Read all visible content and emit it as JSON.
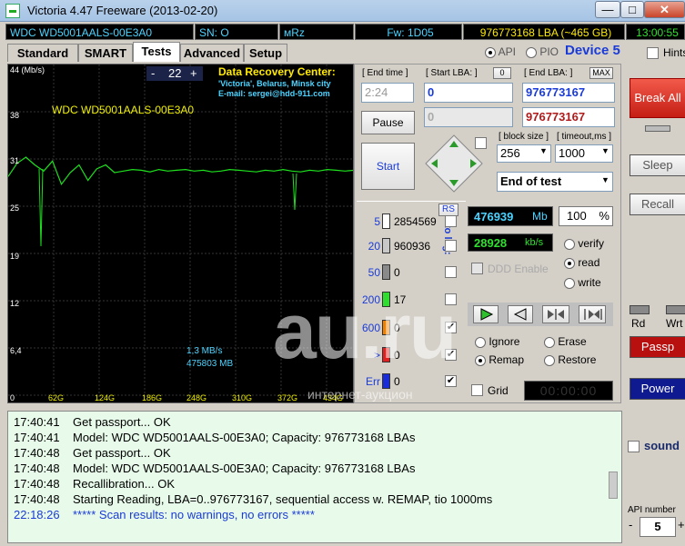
{
  "window": {
    "title": "Victoria 4.47  Freeware (2013-02-20)",
    "minimize": "—",
    "maximize": "□",
    "close": "✕"
  },
  "info": {
    "drive": "WDC WD5001AALS-00E3A0",
    "sn": "SN: O",
    "mrz": "мRz",
    "fw": "Fw: 1D05",
    "lba": "976773168 LBA (~465 GB)",
    "clock": "13:00:55"
  },
  "tabs": [
    "Standard",
    "SMART",
    "Tests",
    "Advanced",
    "Setup"
  ],
  "api": {
    "api_label": "API",
    "pio_label": "PIO",
    "device": "Device 5",
    "hints": "Hints"
  },
  "graph": {
    "y_unit": "44 (Mb/s)",
    "y_ticks": [
      "38",
      "31",
      "25",
      "19",
      "12",
      "6,4",
      "0"
    ],
    "x_ticks": [
      "62G",
      "124G",
      "186G",
      "248G",
      "310G",
      "372G",
      "434G"
    ],
    "drive_label": "WDC WD5001AALS-00E3A0",
    "zoom_minus": "-",
    "zoom_value": "22",
    "zoom_plus": "+",
    "promo_title": "Data Recovery Center:",
    "promo_line1": "'Victoria', Belarus, Minsk city",
    "promo_line2": "E-mail: sergei@hdd-911.com",
    "speed": "1,3 MB/s",
    "pos": "475803 MB",
    "series": [
      29.5,
      31.2,
      32,
      31,
      30.2,
      31.5,
      28.5,
      30,
      31,
      29,
      30.5,
      31,
      30,
      30.2,
      30.4,
      30.3,
      30.1,
      30.4,
      30.2,
      30.3,
      30.4,
      30.2,
      30.3,
      30.1,
      30.2,
      30.4,
      30.3,
      30.2,
      30.1,
      30.3,
      30.2,
      30.4,
      30.2,
      30.1,
      30.3,
      30.2,
      30.4,
      30.3,
      30.2,
      30.3
    ]
  },
  "tests": {
    "end_time_label": "[ End time ]",
    "end_time": "2:24",
    "start_lba_label": "[ Start LBA: ]",
    "start_lba_btn": "0",
    "start_lba": "0",
    "end_lba_label": "[ End LBA: ]",
    "max_btn": "MAX",
    "end_lba": "976773167",
    "cur_lba_grey": "0",
    "cur_lba_red": "976773167",
    "pause": "Pause",
    "start": "Start",
    "block_size_label": "[ block size ]",
    "block_size": "256",
    "timeout_label": "[ timeout,ms ]",
    "timeout": "1000",
    "end_of_test": "End of test"
  },
  "timings": {
    "rs": "RS",
    "to_log": "to log:",
    "rows": [
      {
        "ms": "5",
        "count": "2854569",
        "color": "#ffffff"
      },
      {
        "ms": "20",
        "count": "960936",
        "color": "#c8c8c8"
      },
      {
        "ms": "50",
        "count": "0",
        "color": "#8a8a8a"
      },
      {
        "ms": "200",
        "count": "17",
        "color": "#2fdc2f"
      },
      {
        "ms": "600",
        "count": "0",
        "color": "#f08000"
      },
      {
        "ms": ">",
        "count": "0",
        "color": "#e02020"
      },
      {
        "ms": "Err",
        "count": "0",
        "color": "#1a2bd8"
      }
    ]
  },
  "stats": {
    "mb": "476939",
    "mb_unit": "Mb",
    "percent": "100",
    "percent_unit": "%",
    "kbs": "28928",
    "kbs_unit": "kb/s",
    "ddd": "DDD Enable",
    "verify": "verify",
    "read": "read",
    "write": "write"
  },
  "actions": {
    "ignore": "Ignore",
    "erase": "Erase",
    "remap": "Remap",
    "restore": "Restore",
    "grid": "Grid",
    "grid_time": "00:00:00"
  },
  "log": [
    {
      "t": "17:40:41",
      "m": "Get passport... OK",
      "c": "#000"
    },
    {
      "t": "17:40:41",
      "m": "Model: WDC WD5001AALS-00E3A0; Capacity: 976773168 LBAs",
      "c": "#000"
    },
    {
      "t": "17:40:48",
      "m": "Get passport... OK",
      "c": "#000"
    },
    {
      "t": "17:40:48",
      "m": "Model: WDC WD5001AALS-00E3A0; Capacity: 976773168 LBAs",
      "c": "#000"
    },
    {
      "t": "17:40:48",
      "m": "Recallibration... OK",
      "c": "#000"
    },
    {
      "t": "17:40:48",
      "m": "Starting Reading, LBA=0..976773167, sequential access w. REMAP, tio 1000ms",
      "c": "#000"
    },
    {
      "t": "22:18:26",
      "m": "***** Scan results: no warnings, no errors *****",
      "c": "#1a3bd8"
    }
  ],
  "side": {
    "break_all": "Break All",
    "sleep": "Sleep",
    "recall": "Recall",
    "rd": "Rd",
    "wrt": "Wrt",
    "passp": "Passp",
    "power": "Power",
    "sound": "sound",
    "api_number": "API number",
    "api_value": "5",
    "api_minus": "-",
    "api_plus": "+"
  },
  "watermark": {
    "big": "au.ru",
    "small": "интернет-аукцион"
  }
}
